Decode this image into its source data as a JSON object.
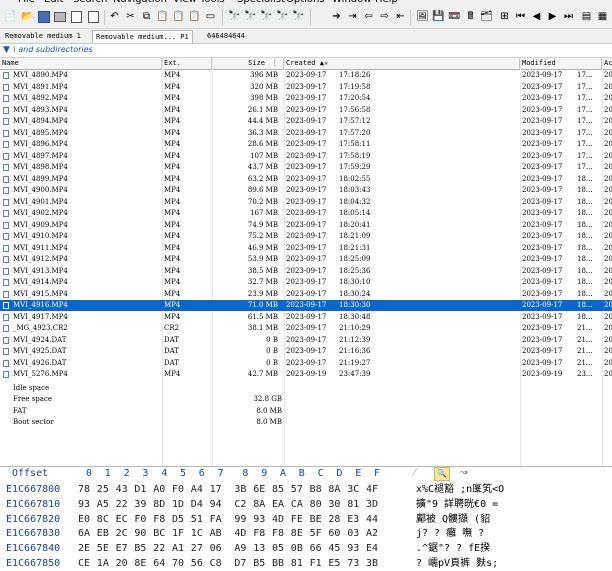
{
  "menu": [
    "File",
    "Edit",
    "Search",
    "Navigation",
    "View",
    "Tools",
    "Specialist",
    "Options",
    "Window",
    "Help"
  ],
  "tabs": [
    {
      "label": "Removable medium 1",
      "active": false
    },
    {
      "label": "Removable medium... P1",
      "active": true
    },
    {
      "label": "646484644",
      "active": false
    }
  ],
  "filter": {
    "text": "\\ and subdirectories"
  },
  "columns": {
    "name": "Name",
    "ext": "Ext.",
    "size": "Size",
    "created": "Created",
    "modified": "Modified",
    "accessed": "Ac"
  },
  "files": [
    {
      "name": "MVI_4890.MP4",
      "ext": "MP4",
      "size": "396 MB",
      "cdate": "2023-09-17",
      "ctime": "17:18:26",
      "mdate": "2023-09-17",
      "mtime": "17...",
      "a": "20"
    },
    {
      "name": "MVI_4891.MP4",
      "ext": "MP4",
      "size": "320 MB",
      "cdate": "2023-09-17",
      "ctime": "17:19:58",
      "mdate": "2023-09-17",
      "mtime": "17...",
      "a": "20"
    },
    {
      "name": "MVI_4892.MP4",
      "ext": "MP4",
      "size": "398 MB",
      "cdate": "2023-09-17",
      "ctime": "17:20:54",
      "mdate": "2023-09-17",
      "mtime": "17...",
      "a": "20"
    },
    {
      "name": "MVI_4893.MP4",
      "ext": "MP4",
      "size": "26.1 MB",
      "cdate": "2023-09-17",
      "ctime": "17:56:58",
      "mdate": "2023-09-17",
      "mtime": "17...",
      "a": "20"
    },
    {
      "name": "MVI_4894.MP4",
      "ext": "MP4",
      "size": "44.4 MB",
      "cdate": "2023-09-17",
      "ctime": "17:57:12",
      "mdate": "2023-09-17",
      "mtime": "17...",
      "a": "20"
    },
    {
      "name": "MVI_4895.MP4",
      "ext": "MP4",
      "size": "36.3 MB",
      "cdate": "2023-09-17",
      "ctime": "17:57:20",
      "mdate": "2023-09-17",
      "mtime": "17...",
      "a": "20"
    },
    {
      "name": "MVI_4896.MP4",
      "ext": "MP4",
      "size": "28.6 MB",
      "cdate": "2023-09-17",
      "ctime": "17:58:11",
      "mdate": "2023-09-17",
      "mtime": "17...",
      "a": "20"
    },
    {
      "name": "MVI_4897.MP4",
      "ext": "MP4",
      "size": "107 MB",
      "cdate": "2023-09-17",
      "ctime": "17:58:19",
      "mdate": "2023-09-17",
      "mtime": "17...",
      "a": "20"
    },
    {
      "name": "MVI_4898.MP4",
      "ext": "MP4",
      "size": "43.7 MB",
      "cdate": "2023-09-17",
      "ctime": "17:59:29",
      "mdate": "2023-09-17",
      "mtime": "17...",
      "a": "20"
    },
    {
      "name": "MVI_4899.MP4",
      "ext": "MP4",
      "size": "63.2 MB",
      "cdate": "2023-09-17",
      "ctime": "18:02:55",
      "mdate": "2023-09-17",
      "mtime": "18...",
      "a": "20"
    },
    {
      "name": "MVI_4900.MP4",
      "ext": "MP4",
      "size": "89.6 MB",
      "cdate": "2023-09-17",
      "ctime": "18:03:43",
      "mdate": "2023-09-17",
      "mtime": "18...",
      "a": "20"
    },
    {
      "name": "MVI_4901.MP4",
      "ext": "MP4",
      "size": "70.2 MB",
      "cdate": "2023-09-17",
      "ctime": "18:04:32",
      "mdate": "2023-09-17",
      "mtime": "18...",
      "a": "20"
    },
    {
      "name": "MVI_4902.MP4",
      "ext": "MP4",
      "size": "167 MB",
      "cdate": "2023-09-17",
      "ctime": "18:05:14",
      "mdate": "2023-09-17",
      "mtime": "18...",
      "a": "20"
    },
    {
      "name": "MVI_4909.MP4",
      "ext": "MP4",
      "size": "74.9 MB",
      "cdate": "2023-09-17",
      "ctime": "18:20:41",
      "mdate": "2023-09-17",
      "mtime": "18...",
      "a": "20"
    },
    {
      "name": "MVI_4910.MP4",
      "ext": "MP4",
      "size": "75.2 MB",
      "cdate": "2023-09-17",
      "ctime": "18:21:09",
      "mdate": "2023-09-17",
      "mtime": "18...",
      "a": "20"
    },
    {
      "name": "MVI_4911.MP4",
      "ext": "MP4",
      "size": "46.9 MB",
      "cdate": "2023-09-17",
      "ctime": "18:21:31",
      "mdate": "2023-09-17",
      "mtime": "18...",
      "a": "20"
    },
    {
      "name": "MVI_4912.MP4",
      "ext": "MP4",
      "size": "53.9 MB",
      "cdate": "2023-09-17",
      "ctime": "18:25:09",
      "mdate": "2023-09-17",
      "mtime": "18...",
      "a": "20"
    },
    {
      "name": "MVI_4913.MP4",
      "ext": "MP4",
      "size": "38.5 MB",
      "cdate": "2023-09-17",
      "ctime": "18:25:36",
      "mdate": "2023-09-17",
      "mtime": "18...",
      "a": "20"
    },
    {
      "name": "MVI_4914.MP4",
      "ext": "MP4",
      "size": "32.7 MB",
      "cdate": "2023-09-17",
      "ctime": "18:30:10",
      "mdate": "2023-09-17",
      "mtime": "18...",
      "a": "20"
    },
    {
      "name": "MVI_4915.MP4",
      "ext": "MP4",
      "size": "23.9 MB",
      "cdate": "2023-09-17",
      "ctime": "18:30:24",
      "mdate": "2023-09-17",
      "mtime": "18...",
      "a": "20"
    },
    {
      "name": "MVI_4916.MP4",
      "ext": "MP4",
      "size": "71.0 MB",
      "cdate": "2023-09-17",
      "ctime": "18:30:30",
      "mdate": "2023-09-17",
      "mtime": "18...",
      "a": "20",
      "selected": true
    },
    {
      "name": "MVI_4917.MP4",
      "ext": "MP4",
      "size": "61.5 MB",
      "cdate": "2023-09-17",
      "ctime": "18:30:48",
      "mdate": "2023-09-17",
      "mtime": "18...",
      "a": "20"
    },
    {
      "name": "_MG_4923.CR2",
      "ext": "CR2",
      "size": "38.1 MB",
      "cdate": "2023-09-17",
      "ctime": "21:10:29",
      "mdate": "2023-09-17",
      "mtime": "21...",
      "a": "20"
    },
    {
      "name": "MVI_4924.DAT",
      "ext": "DAT",
      "size": "0 B",
      "cdate": "2023-09-17",
      "ctime": "21:12:39",
      "mdate": "2023-09-17",
      "mtime": "21...",
      "a": "20"
    },
    {
      "name": "MVI_4925.DAT",
      "ext": "DAT",
      "size": "0 B",
      "cdate": "2023-09-17",
      "ctime": "21:16:36",
      "mdate": "2023-09-17",
      "mtime": "21...",
      "a": "20"
    },
    {
      "name": "MVI_4926.DAT",
      "ext": "DAT",
      "size": "0 B",
      "cdate": "2023-09-17",
      "ctime": "21:19:27",
      "mdate": "2023-09-17",
      "mtime": "21...",
      "a": "20"
    },
    {
      "name": "MVI_5276.MP4",
      "ext": "MP4",
      "size": "42.7 MB",
      "cdate": "2023-09-19",
      "ctime": "23:47:39",
      "mdate": "2023-09-19",
      "mtime": "23...",
      "a": "20"
    }
  ],
  "special": [
    {
      "name": "Idle space",
      "size": ""
    },
    {
      "name": "Free space",
      "size": "32.8 GB"
    },
    {
      "name": "FAT",
      "size": "8.0 MB"
    },
    {
      "name": "Boot sector",
      "size": "8.0 MB"
    }
  ],
  "hex": {
    "offset_label": "Offset",
    "columns": [
      "0",
      "1",
      "2",
      "3",
      "4",
      "5",
      "6",
      "7",
      "8",
      "9",
      "A",
      "B",
      "C",
      "D",
      "E",
      "F"
    ],
    "rows": [
      {
        "offset": "E1C667800",
        "bytes": [
          "78",
          "25",
          "43",
          "D1",
          "A0",
          "F0",
          "A4",
          "17",
          "3B",
          "6E",
          "85",
          "57",
          "B8",
          "8A",
          "3C",
          "4F"
        ],
        "ascii": "x%C褪豁 ;n匽笂<O"
      },
      {
        "offset": "E1C667810",
        "bytes": [
          "93",
          "A5",
          "22",
          "39",
          "8D",
          "1D",
          "D4",
          "94",
          "C2",
          "8A",
          "EA",
          "CA",
          "80",
          "30",
          "81",
          "3D"
        ],
        "ascii": "擴\"9  詳聘晄€0 ="
      },
      {
        "offset": "E1C667820",
        "bytes": [
          "E0",
          "8C",
          "EC",
          "F0",
          "F8",
          "D5",
          "51",
          "FA",
          "99",
          "93",
          "4D",
          "FE",
          "BE",
          "28",
          "E3",
          "44"
        ],
        "ascii": "鄺被  Q髏擷  (貂"
      },
      {
        "offset": "E1C667830",
        "bytes": [
          "6A",
          "EB",
          "2C",
          "90",
          "BC",
          "1F",
          "1C",
          "AB",
          "4D",
          "F8",
          "F8",
          "8E",
          "5F",
          "60",
          "03",
          "A2"
        ],
        "ascii": "j? ? 癰  嘸  ?"
      },
      {
        "offset": "E1C667840",
        "bytes": [
          "2E",
          "5E",
          "E7",
          "B5",
          "22",
          "A1",
          "27",
          "06",
          "A9",
          "13",
          "05",
          "0B",
          "66",
          "45",
          "93",
          "E4"
        ],
        "ascii": ".^鋸\"? ?  fE揆"
      },
      {
        "offset": "E1C667850",
        "bytes": [
          "CE",
          "1A",
          "20",
          "8E",
          "64",
          "70",
          "56",
          "C8",
          "D7",
          "B5",
          "BB",
          "81",
          "F1",
          "E5",
          "73",
          "3B"
        ],
        "ascii": "? 嶿pV頁裤  麩s;"
      }
    ]
  }
}
